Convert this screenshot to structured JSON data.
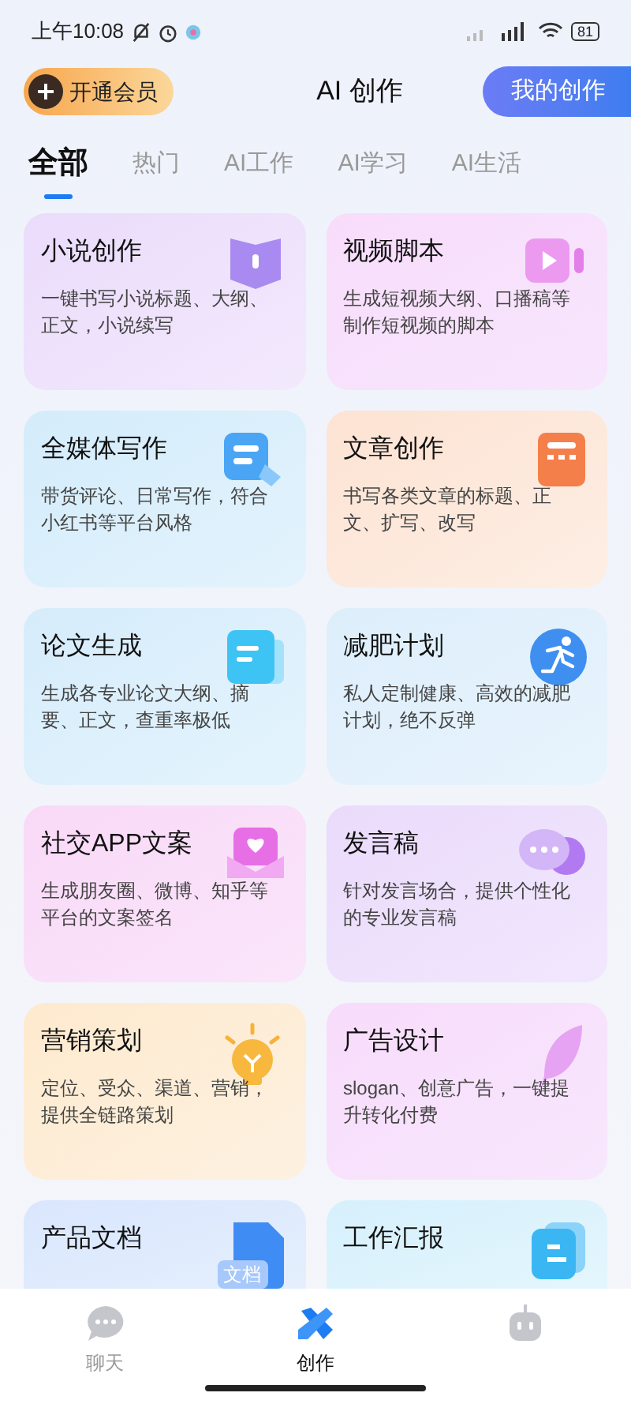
{
  "status_bar": {
    "time": "上午10:08",
    "battery": "81"
  },
  "header": {
    "vip_button": "开通会员",
    "title": "AI 创作",
    "my_button": "我的创作"
  },
  "tabs": [
    {
      "label": "全部",
      "selected": true
    },
    {
      "label": "热门",
      "selected": false
    },
    {
      "label": "AI工作",
      "selected": false
    },
    {
      "label": "AI学习",
      "selected": false
    },
    {
      "label": "AI生活",
      "selected": false
    }
  ],
  "cards": [
    {
      "title": "小说创作",
      "description": "一键书写小说标题、大纲、正文，小说续写"
    },
    {
      "title": "视频脚本",
      "description": "生成短视频大纲、口播稿等制作短视频的脚本"
    },
    {
      "title": "全媒体写作",
      "description": "带货评论、日常写作，符合小红书等平台风格"
    },
    {
      "title": "文章创作",
      "description": "书写各类文章的标题、正文、扩写、改写"
    },
    {
      "title": "论文生成",
      "description": "生成各专业论文大纲、摘要、正文，查重率极低"
    },
    {
      "title": "减肥计划",
      "description": "私人定制健康、高效的减肥计划，绝不反弹"
    },
    {
      "title": "社交APP文案",
      "description": "生成朋友圈、微博、知乎等平台的文案签名"
    },
    {
      "title": "发言稿",
      "description": "针对发言场合，提供个性化的专业发言稿"
    },
    {
      "title": "营销策划",
      "description": "定位、受众、渠道、营销，提供全链路策划"
    },
    {
      "title": "广告设计",
      "description": "slogan、创意广告，一键提升转化付费"
    },
    {
      "title": "产品文档",
      "badge": "文档"
    },
    {
      "title": "工作汇报"
    }
  ],
  "bottom_nav": [
    {
      "label": "聊天",
      "selected": false
    },
    {
      "label": "创作",
      "selected": true
    },
    {
      "selected": false
    }
  ]
}
